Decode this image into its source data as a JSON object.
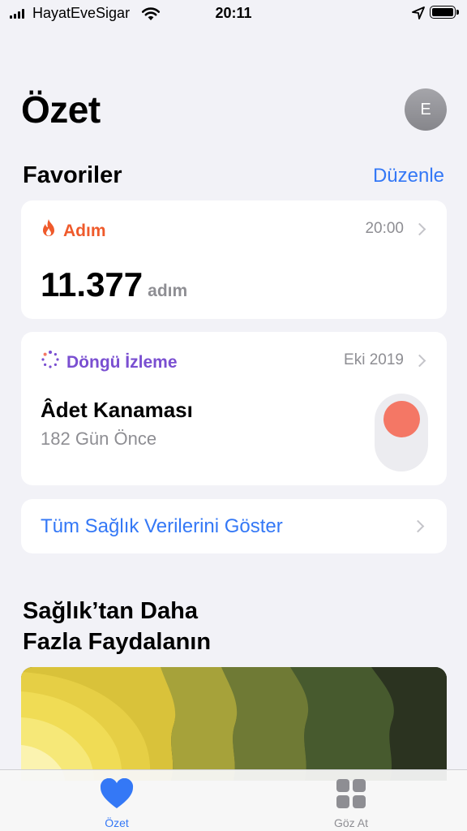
{
  "status_bar": {
    "carrier": "HayatEveSigar",
    "time": "20:11",
    "icons": [
      "signal-icon",
      "wifi-icon",
      "location-icon",
      "battery-icon"
    ]
  },
  "header": {
    "title": "Özet",
    "avatar_initial": "E"
  },
  "favorites": {
    "title": "Favoriler",
    "edit_label": "Düzenle",
    "steps": {
      "label": "Adım",
      "icon": "flame-icon",
      "time": "20:00",
      "value": "11.377",
      "unit": "adım",
      "color": "#ef5a2b"
    },
    "cycle": {
      "label": "Döngü İzleme",
      "icon": "cycle-tracking-icon",
      "date": "Eki 2019",
      "title": "Âdet Kanaması",
      "subtitle": "182 Gün Önce",
      "color": "#7a4fd1",
      "dot_color": "#f47765"
    },
    "show_all_label": "Tüm Sağlık Verilerini Göster"
  },
  "promo": {
    "title_line1": "Sağlık’tan Daha",
    "title_line2": "Fazla Faydalanın"
  },
  "tab_bar": {
    "tabs": [
      {
        "label": "Özet",
        "icon": "heart-icon",
        "active": true
      },
      {
        "label": "Göz At",
        "icon": "grid-icon",
        "active": false
      }
    ],
    "accent": "#3478f6"
  }
}
